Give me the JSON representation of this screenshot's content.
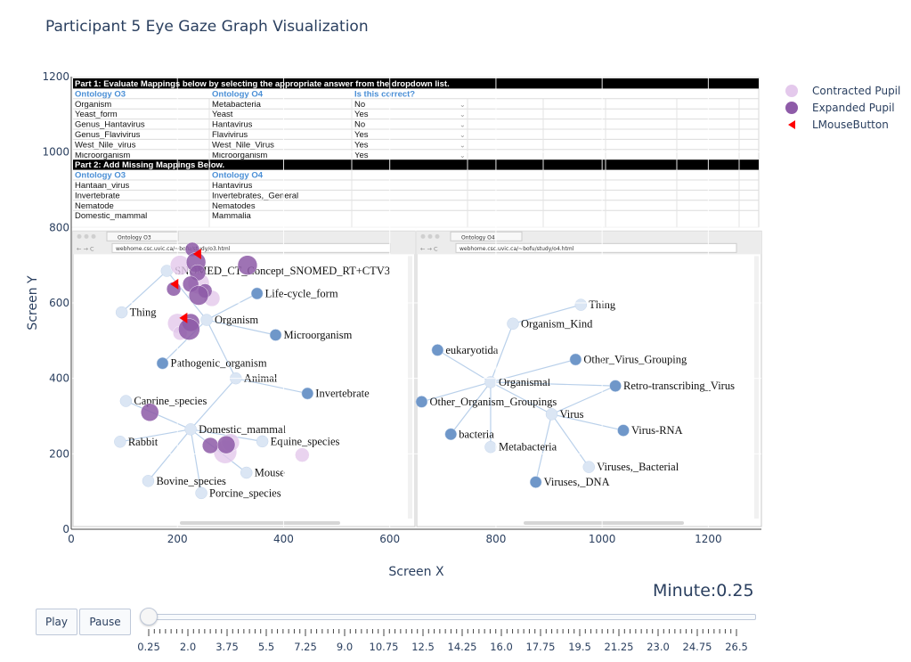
{
  "title": "Participant 5 Eye Gaze Graph Visualization",
  "chart_data": {
    "type": "scatter",
    "xlabel": "Screen X",
    "ylabel": "Screen Y",
    "xlim": [
      0,
      1300
    ],
    "ylim": [
      0,
      1200
    ],
    "x_ticks": [
      0,
      200,
      400,
      600,
      800,
      1000,
      1200
    ],
    "y_ticks": [
      0,
      200,
      400,
      600,
      800,
      1000,
      1200
    ],
    "legend_position": "top-right",
    "series": [
      {
        "name": "Contracted Pupil",
        "color": "#e4c9ec",
        "points": [
          {
            "x": 205,
            "y": 700,
            "size": 22
          },
          {
            "x": 240,
            "y": 652,
            "size": 24
          },
          {
            "x": 265,
            "y": 612,
            "size": 18
          },
          {
            "x": 200,
            "y": 546,
            "size": 22
          },
          {
            "x": 205,
            "y": 520,
            "size": 16
          },
          {
            "x": 290,
            "y": 205,
            "size": 26
          },
          {
            "x": 300,
            "y": 230,
            "size": 20
          },
          {
            "x": 435,
            "y": 197,
            "size": 16
          }
        ]
      },
      {
        "name": "Expanded Pupil",
        "color": "#8e5ba8",
        "points": [
          {
            "x": 228,
            "y": 742,
            "size": 16
          },
          {
            "x": 235,
            "y": 708,
            "size": 22
          },
          {
            "x": 238,
            "y": 680,
            "size": 18
          },
          {
            "x": 332,
            "y": 700,
            "size": 22
          },
          {
            "x": 225,
            "y": 650,
            "size": 18
          },
          {
            "x": 193,
            "y": 637,
            "size": 16
          },
          {
            "x": 252,
            "y": 632,
            "size": 16
          },
          {
            "x": 240,
            "y": 620,
            "size": 22
          },
          {
            "x": 225,
            "y": 548,
            "size": 20
          },
          {
            "x": 222,
            "y": 530,
            "size": 24
          },
          {
            "x": 148,
            "y": 310,
            "size": 20
          },
          {
            "x": 262,
            "y": 222,
            "size": 18
          },
          {
            "x": 292,
            "y": 224,
            "size": 20
          }
        ]
      },
      {
        "name": "LMouseButton",
        "color": "#ff0000",
        "marker": "triangle-left",
        "points": [
          {
            "x": 238,
            "y": 730
          },
          {
            "x": 195,
            "y": 650
          },
          {
            "x": 212,
            "y": 560
          }
        ]
      }
    ]
  },
  "slider": {
    "current_label": "Minute:0.25",
    "value": 0.25,
    "min": 0.25,
    "max": 26.5,
    "labels": [
      "0.25",
      "2.0",
      "3.75",
      "5.5",
      "7.25",
      "9.0",
      "10.75",
      "12.5",
      "14.25",
      "16.0",
      "17.75",
      "19.5",
      "21.25",
      "23.0",
      "24.75",
      "26.5"
    ]
  },
  "controls": {
    "play_label": "Play",
    "pause_label": "Pause"
  },
  "background_screenshot": {
    "table_part1_header": "Part 1: Evaluate Mappings below by selecting the appropriate answer from the dropdown list.",
    "table_col1": "Ontology O3",
    "table_col2": "Ontology O4",
    "table_col3": "Is this correct?",
    "part1_rows": [
      [
        "Organism",
        "Metabacteria",
        "No"
      ],
      [
        "Yeast_form",
        "Yeast",
        "Yes"
      ],
      [
        "Genus_Hantavirus",
        "Hantavirus",
        "No"
      ],
      [
        "Genus_Flavivirus",
        "Flavivirus",
        "Yes"
      ],
      [
        "West_Nile_virus",
        "West_Nile_Virus",
        "Yes"
      ],
      [
        "Microorganism",
        "Microorganism",
        "Yes"
      ]
    ],
    "table_part2_header": "Part 2: Add Missing Mappings Below.",
    "part2_rows": [
      [
        "Hantaan_virus",
        "Hantavirus"
      ],
      [
        "Invertebrate",
        "Invertebrates,_General"
      ],
      [
        "Nematode",
        "Nematodes"
      ],
      [
        "Domestic_mammal",
        "Mammalia"
      ]
    ],
    "left_tab": "Ontology O3",
    "left_url": "webhome.csc.uvic.ca/~bofu/study/o3.html",
    "right_tab": "Ontology O4",
    "right_url": "webhome.csc.uvic.ca/~bofu/study/o4.html",
    "left_nodes": [
      {
        "label": "SNOMED_CT_Concept_SNOMED_RT+CTV3",
        "x": 180,
        "y": 685,
        "color": "#dbe6f4"
      },
      {
        "label": "Life-cycle_form",
        "x": 350,
        "y": 625,
        "color": "#6f97c9"
      },
      {
        "label": "Thing",
        "x": 95,
        "y": 575,
        "color": "#dbe6f4"
      },
      {
        "label": "Organism",
        "x": 255,
        "y": 555,
        "color": "#dbe6f4"
      },
      {
        "label": "Microorganism",
        "x": 385,
        "y": 515,
        "color": "#6f97c9"
      },
      {
        "label": "Pathogenic_organism",
        "x": 172,
        "y": 440,
        "color": "#6f97c9"
      },
      {
        "label": "Animal",
        "x": 310,
        "y": 400,
        "color": "#dbe6f4"
      },
      {
        "label": "Invertebrate",
        "x": 445,
        "y": 360,
        "color": "#6f97c9"
      },
      {
        "label": "Caprine_species",
        "x": 103,
        "y": 340,
        "color": "#dbe6f4"
      },
      {
        "label": "Domestic_mammal",
        "x": 225,
        "y": 265,
        "color": "#dbe6f4"
      },
      {
        "label": "Rabbit",
        "x": 92,
        "y": 232,
        "color": "#dbe6f4"
      },
      {
        "label": "Equine_species",
        "x": 360,
        "y": 233,
        "color": "#dbe6f4"
      },
      {
        "label": "Mouse",
        "x": 330,
        "y": 150,
        "color": "#dbe6f4"
      },
      {
        "label": "Bovine_species",
        "x": 145,
        "y": 128,
        "color": "#dbe6f4"
      },
      {
        "label": "Porcine_species",
        "x": 245,
        "y": 96,
        "color": "#dbe6f4"
      }
    ],
    "left_edges": [
      [
        2,
        0
      ],
      [
        0,
        3
      ],
      [
        3,
        1
      ],
      [
        3,
        4
      ],
      [
        3,
        5
      ],
      [
        3,
        6
      ],
      [
        6,
        7
      ],
      [
        6,
        9
      ],
      [
        8,
        9
      ],
      [
        10,
        9
      ],
      [
        9,
        11
      ],
      [
        9,
        12
      ],
      [
        9,
        13
      ],
      [
        9,
        14
      ]
    ],
    "right_nodes": [
      {
        "label": "Thing",
        "x": 960,
        "y": 595,
        "color": "#dbe6f4"
      },
      {
        "label": "Organism_Kind",
        "x": 832,
        "y": 545,
        "color": "#dbe6f4"
      },
      {
        "label": "eukaryotida",
        "x": 690,
        "y": 475,
        "color": "#6f97c9"
      },
      {
        "label": "Other_Virus_Grouping",
        "x": 950,
        "y": 450,
        "color": "#6f97c9"
      },
      {
        "label": "Organismal",
        "x": 790,
        "y": 390,
        "color": "#dbe6f4"
      },
      {
        "label": "Retro-transcribing_Virus",
        "x": 1025,
        "y": 380,
        "color": "#6f97c9"
      },
      {
        "label": "Other_Organism_Groupings",
        "x": 660,
        "y": 338,
        "color": "#6f97c9"
      },
      {
        "label": "Virus",
        "x": 905,
        "y": 305,
        "color": "#dbe6f4"
      },
      {
        "label": "Virus-RNA",
        "x": 1040,
        "y": 262,
        "color": "#6f97c9"
      },
      {
        "label": "bacteria",
        "x": 715,
        "y": 252,
        "color": "#6f97c9"
      },
      {
        "label": "Metabacteria",
        "x": 790,
        "y": 218,
        "color": "#dbe6f4"
      },
      {
        "label": "Viruses,_Bacterial",
        "x": 975,
        "y": 165,
        "color": "#dbe6f4"
      },
      {
        "label": "Viruses,_DNA",
        "x": 875,
        "y": 125,
        "color": "#6f97c9"
      }
    ],
    "right_edges": [
      [
        1,
        0
      ],
      [
        4,
        1
      ],
      [
        4,
        2
      ],
      [
        4,
        3
      ],
      [
        4,
        5
      ],
      [
        4,
        6
      ],
      [
        4,
        7
      ],
      [
        7,
        8
      ],
      [
        7,
        11
      ],
      [
        7,
        12
      ],
      [
        4,
        9
      ],
      [
        4,
        10
      ],
      [
        7,
        5
      ]
    ]
  }
}
